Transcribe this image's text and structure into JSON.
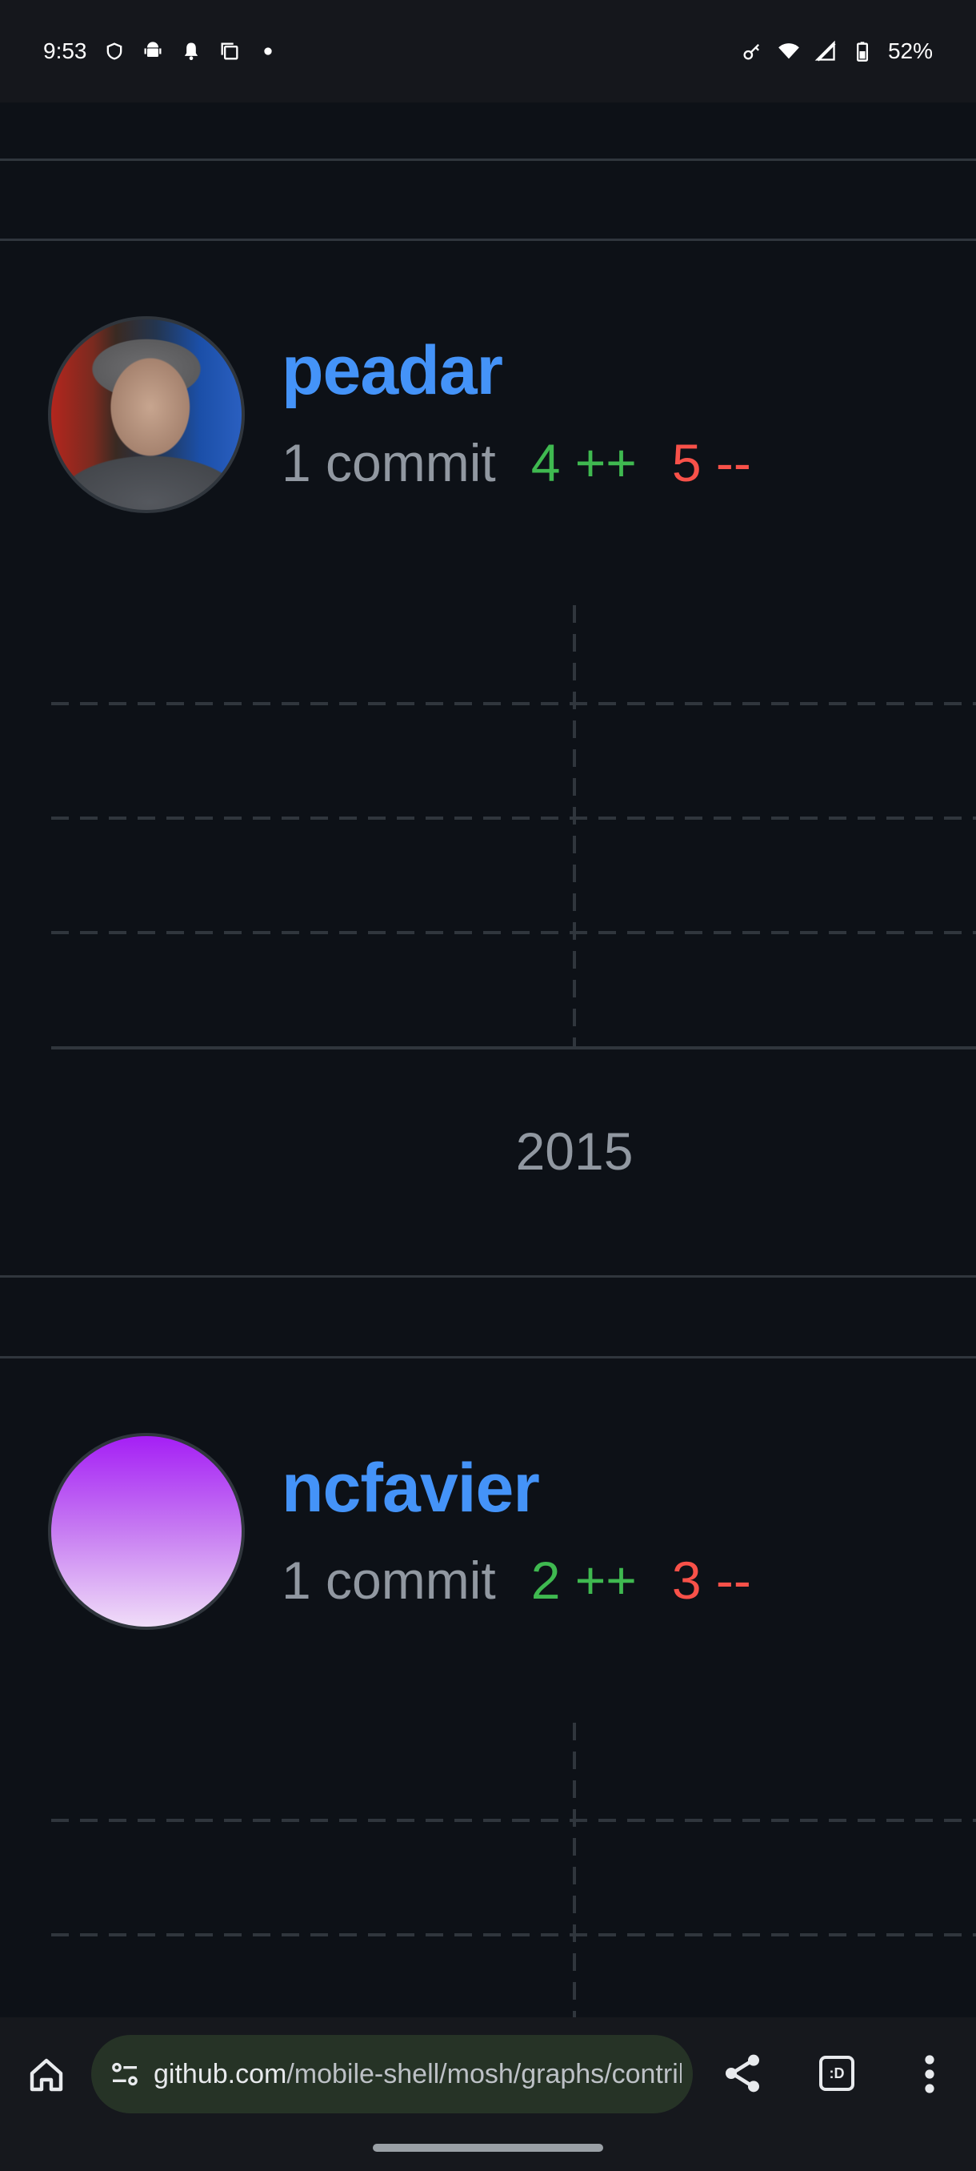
{
  "status_bar": {
    "time": "9:53",
    "battery": "52%",
    "icons": [
      "vpn-shield-icon",
      "android-icon",
      "notification-bell-icon",
      "copy-icon",
      "dot-icon",
      "key-icon",
      "wifi-icon",
      "signal-icon",
      "battery-icon"
    ]
  },
  "contributors": [
    {
      "username": "peadar",
      "commits": "1 commit",
      "additions": "4 ++",
      "deletions": "5 --",
      "year_label": "2015"
    },
    {
      "username": "ncfavier",
      "commits": "1 commit",
      "additions": "2 ++",
      "deletions": "3 --"
    }
  ],
  "browser": {
    "url_domain": "github.com",
    "url_path": "/mobile-shell/mosh/graphs/contrib",
    "tab_label": ":D",
    "icons": [
      "home-icon",
      "site-settings-icon",
      "share-icon",
      "tab-switcher-icon",
      "more-vert-icon"
    ]
  },
  "colors": {
    "background": "#0d1117",
    "link": "#4493f8",
    "additions": "#3fb950",
    "deletions": "#f85149",
    "muted": "#9198a1"
  }
}
